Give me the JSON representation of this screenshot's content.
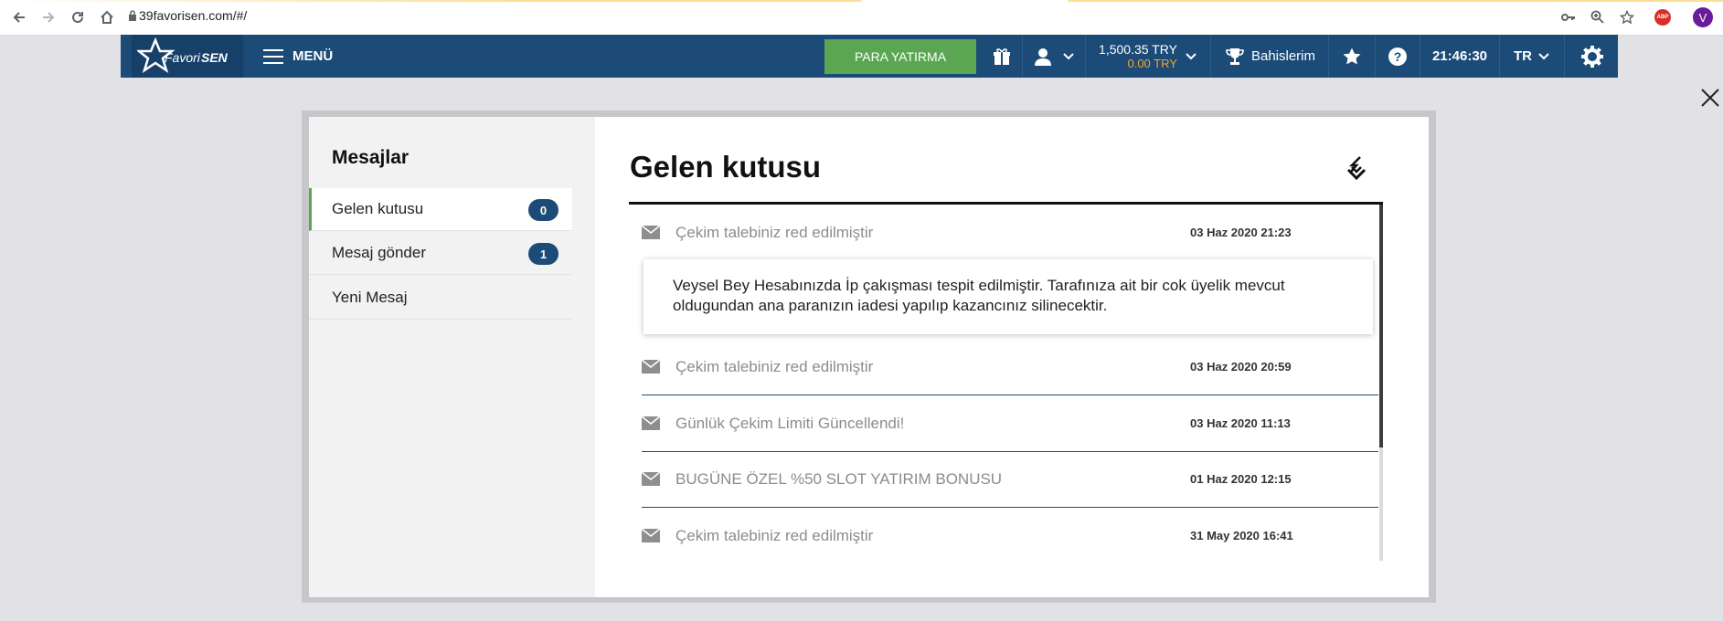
{
  "browser": {
    "url": "39favorisen.com/#/",
    "profile_initial": "V",
    "adblock_label": "ABP"
  },
  "header": {
    "logo_text": "FavoriSEN",
    "menu_label": "MENÜ",
    "deposit_label": "PARA YATIRMA",
    "balance_main": "1,500.35 TRY",
    "balance_bonus": "0.00 TRY",
    "bets_label": "Bahislerim",
    "time": "21:46:30",
    "language": "TR",
    "colors": {
      "bar": "#1b4b76",
      "deposit": "#5ba653",
      "bonus": "#f2a534"
    }
  },
  "sidebar": {
    "title": "Mesajlar",
    "items": [
      {
        "label": "Gelen kutusu",
        "badge": "0"
      },
      {
        "label": "Mesaj gönder",
        "badge": "1"
      },
      {
        "label": "Yeni Mesaj"
      }
    ]
  },
  "inbox": {
    "title": "Gelen kutusu",
    "messages": [
      {
        "subject": "Çekim talebiniz red edilmiştir",
        "date": "03 Haz 2020 21:23",
        "body": "Veysel Bey Hesabınızda İp çakışması tespit edilmiştir. Tarafınıza ait bir cok üyelik mevcut oldugundan ana paranızın iadesi yapılıp kazancınız silinecektir."
      },
      {
        "subject": "Çekim talebiniz red edilmiştir",
        "date": "03 Haz 2020 20:59"
      },
      {
        "subject": "Günlük Çekim Limiti Güncellendi!",
        "date": "03 Haz 2020 11:13"
      },
      {
        "subject": "BUGÜNE ÖZEL %50 SLOT YATIRIM BONUSU",
        "date": "01 Haz 2020 12:15"
      },
      {
        "subject": "Çekim talebiniz red edilmiştir",
        "date": "31 May 2020 16:41"
      }
    ]
  },
  "icons": [
    "back-icon",
    "forward-icon",
    "reload-icon",
    "home-icon",
    "lock-icon",
    "key-icon",
    "zoom-icon",
    "bookmark-star-icon",
    "menu-icon",
    "gift-icon",
    "user-icon",
    "trophy-icon",
    "favorites-star-icon",
    "help-icon",
    "settings-gear-icon",
    "close-icon",
    "collapse-icon",
    "envelope-icon"
  ]
}
